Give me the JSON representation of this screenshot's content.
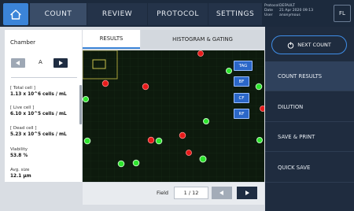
{
  "top_nav": {
    "tabs": [
      {
        "label": "COUNT",
        "active": true
      },
      {
        "label": "REVIEW",
        "active": false
      },
      {
        "label": "PROTOCOL",
        "active": false
      },
      {
        "label": "SETTINGS",
        "active": false
      }
    ],
    "info": {
      "protocol_key": "Protocol",
      "protocol_val": "DEFAULT",
      "date_key": "Date",
      "date_val": "21 Apr 2020 09:13",
      "user_key": "User",
      "user_val": "anonymous"
    },
    "user_initials": "FL"
  },
  "left_panel": {
    "chamber_title": "Chamber",
    "chamber_value": "A",
    "stats": {
      "total_label": "[ Total cell ]",
      "total_value": "1.13 x 10^6 cells / mL",
      "live_label": "[ Live cell ]",
      "live_value": "6.10 x 10^5 cells / mL",
      "dead_label": "[ Dead cell ]",
      "dead_value": "5.23 x 10^5 cells / mL",
      "viability_label": "Viability",
      "viability_value": "53.8 %",
      "avg_size_label": "Avg. size",
      "avg_size_value": "12.1 µm"
    }
  },
  "sub_tabs": {
    "results": "RESULTS",
    "histogram": "HISTOGRAM & GATING"
  },
  "viewer_buttons": {
    "tag": "TAG",
    "bf": "BF",
    "cf": "CF",
    "rf": "RF"
  },
  "field_nav": {
    "label": "Field",
    "value": "1 / 12"
  },
  "right_panel": {
    "next_count": "NEXT COUNT",
    "menu": [
      {
        "label": "COUNT RESULTS",
        "active": true
      },
      {
        "label": "DILUTION",
        "active": false
      },
      {
        "label": "SAVE & PRINT",
        "active": false
      },
      {
        "label": "QUICK SAVE",
        "active": false
      }
    ]
  },
  "colors": {
    "live_cell": "#2ee62e",
    "dead_cell": "#e61a1a",
    "accent": "#3b84d8"
  }
}
